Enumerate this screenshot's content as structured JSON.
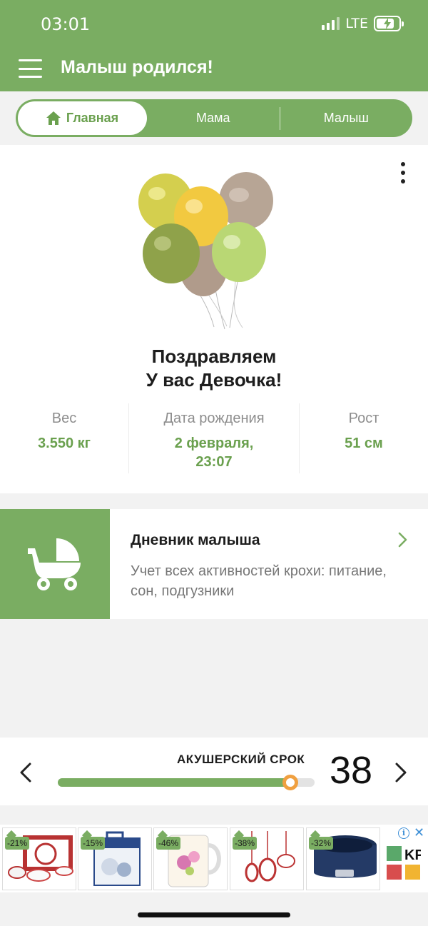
{
  "status_bar": {
    "time": "03:01",
    "network": "LTE"
  },
  "header": {
    "title": "Малыш родился!"
  },
  "tabs": [
    {
      "label": "Главная",
      "active": true,
      "icon": "home-icon"
    },
    {
      "label": "Мама",
      "active": false
    },
    {
      "label": "Малыш",
      "active": false
    }
  ],
  "card": {
    "congrats_line1": "Поздравляем",
    "congrats_line2": "У вас Девочка!",
    "stats": [
      {
        "label": "Вес",
        "value": "3.550 кг"
      },
      {
        "label": "Дата рождения",
        "value_line1": "2 февраля,",
        "value_line2": "23:07"
      },
      {
        "label": "Рост",
        "value": "51 см"
      }
    ]
  },
  "diary": {
    "title": "Дневник малыша",
    "description": "Учет всех активностей крохи: питание, сон, подгузники",
    "icon": "stroller-icon"
  },
  "term": {
    "label": "АКУШЕРСКИЙ СРОК",
    "week": "38",
    "progress": 0.905
  },
  "ads": {
    "items": [
      {
        "discount": "-21%"
      },
      {
        "discount": "-15%"
      },
      {
        "discount": "-46%"
      },
      {
        "discount": "-38%"
      },
      {
        "discount": "-32%"
      }
    ],
    "info_label": "i",
    "close_label": "✕"
  },
  "colors": {
    "brand_green": "#7aad62",
    "accent_orange": "#f0a040",
    "text_dark": "#1d1d1d"
  }
}
